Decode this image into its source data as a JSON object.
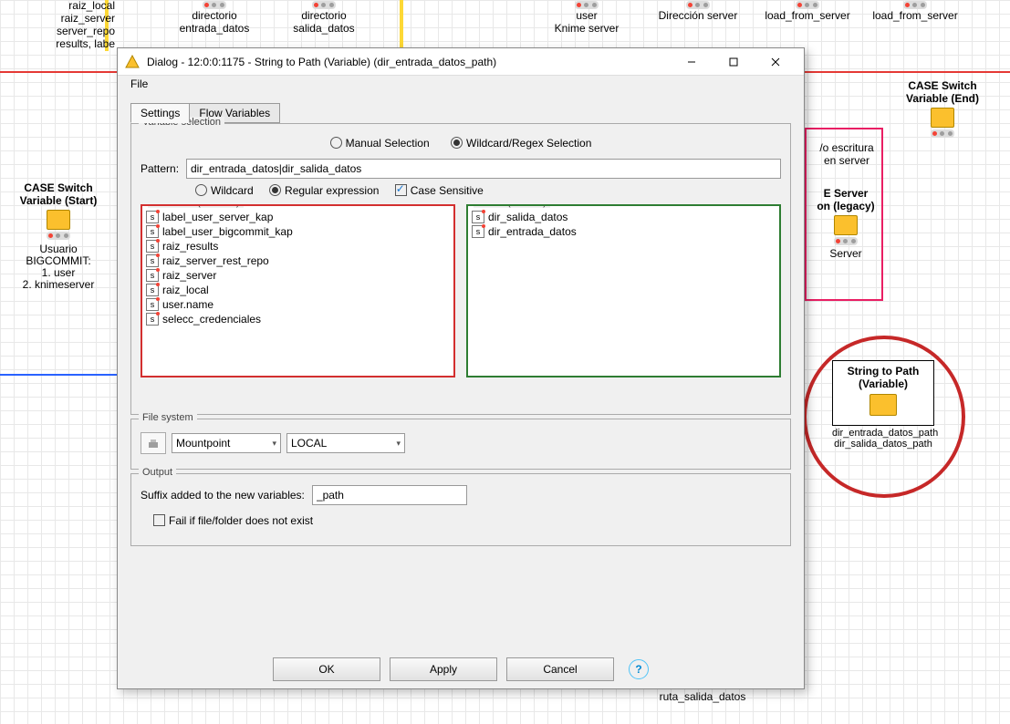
{
  "dialog": {
    "title": "Dialog - 12:0:0:1175 - String to Path (Variable) (dir_entrada_datos_path)",
    "menu": {
      "file": "File"
    },
    "tabs": {
      "settings": "Settings",
      "flowvars": "Flow Variables"
    },
    "varsel": {
      "legend": "Variable selection",
      "mode_manual": "Manual Selection",
      "mode_wildregex": "Wildcard/Regex Selection",
      "pattern_label": "Pattern:",
      "pattern_value": "dir_entrada_datos|dir_salida_datos",
      "wildcard": "Wildcard",
      "regex": "Regular expression",
      "case_sensitive": "Case Sensitive",
      "exclude_legend": "Mismatch (Exclude)",
      "include_legend": "Match (Include)",
      "exclude_items": [
        "label_user_server_kap",
        "label_user_bigcommit_kap",
        "raiz_results",
        "raiz_server_rest_repo",
        "raiz_server",
        "raiz_local",
        "user.name",
        "selecc_credenciales"
      ],
      "include_items": [
        "dir_salida_datos",
        "dir_entrada_datos"
      ]
    },
    "fs": {
      "legend": "File system",
      "select1": "Mountpoint",
      "select2": "LOCAL"
    },
    "output": {
      "legend": "Output",
      "suffix_label": "Suffix added to the new variables:",
      "suffix_value": "_path",
      "fail_label": "Fail if file/folder does not exist"
    },
    "buttons": {
      "ok": "OK",
      "apply": "Apply",
      "cancel": "Cancel"
    }
  },
  "bg": {
    "nodes": {
      "raiz_block": "raiz_local\nraiz_server\nserver_repo\nresults, labe",
      "dir_entrada": "directorio\nentrada_datos",
      "dir_salida": "directorio\nsalida_datos",
      "user_knime": "user\nKnime server",
      "dir_server": "Dirección server",
      "load1": "load_from_server",
      "load2": "load_from_server",
      "case_end_title": "CASE Switch\nVariable (End)",
      "case_start_title": "CASE Switch\nVariable (Start)",
      "usuario": "Usuario\nBIGCOMMIT:\n1. user\n2. knimeserver",
      "escritura": "/o escritura\nen server",
      "eserver": "E Server\non (legacy)",
      "server_txt": "Server",
      "str2path_title": "String to Path\n(Variable)",
      "str2path_sub": "dir_entrada_datos_path\ndir_salida_datos_path",
      "ruta_salida": "ruta_salida_datos"
    }
  }
}
